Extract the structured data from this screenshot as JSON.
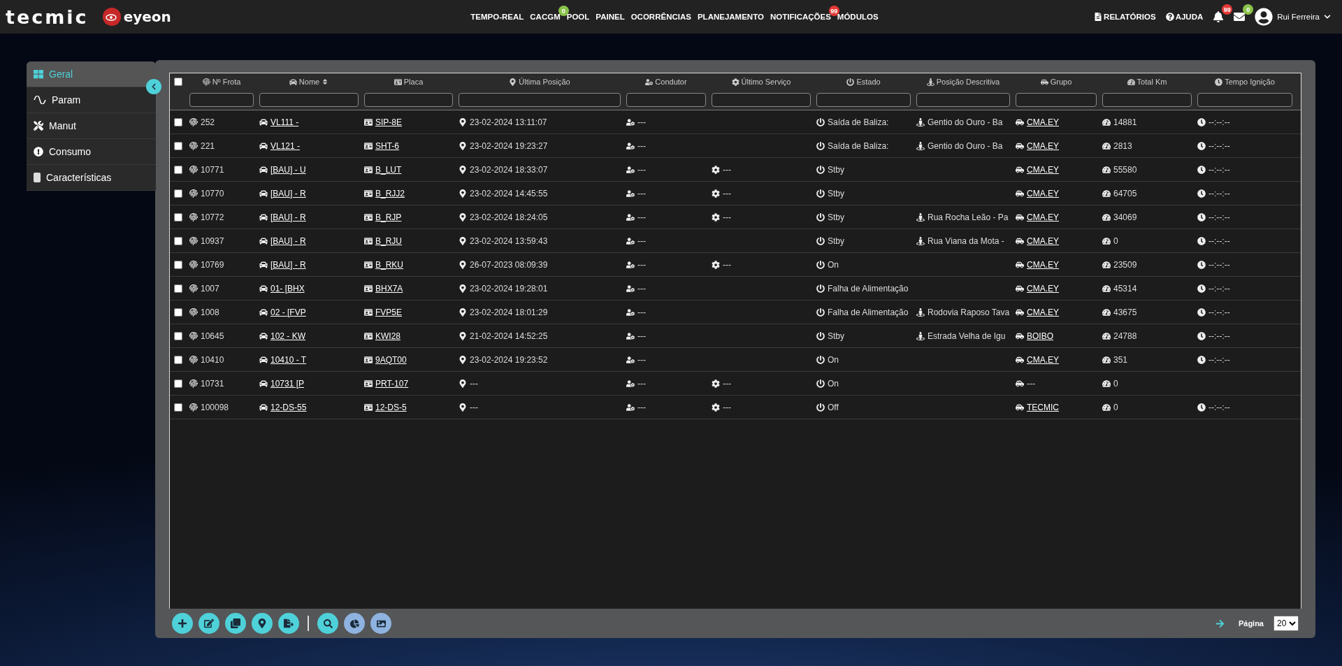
{
  "brand": {
    "tecmic": "tecmic",
    "eyeon": "eyeon"
  },
  "nav": [
    {
      "label": "TEMPO-REAL"
    },
    {
      "label": "CACGM",
      "badge": {
        "text": "0",
        "color": "#8bc34a"
      }
    },
    {
      "label": "POOL"
    },
    {
      "label": "PAINEL"
    },
    {
      "label": "OCORRÊNCIAS"
    },
    {
      "label": "PLANEJAMENTO"
    },
    {
      "label": "NOTIFICAÇÕES",
      "badge": {
        "text": "99",
        "color": "#e53935"
      }
    },
    {
      "label": "MÓDULOS"
    }
  ],
  "top_right": {
    "reports": "RELATÓRIOS",
    "help": "AJUDA",
    "bell_badge": {
      "text": "99",
      "color": "#e53935"
    },
    "mail_badge": {
      "text": "0",
      "color": "#8bc34a"
    },
    "user": "Rui Ferreira"
  },
  "sidebar": {
    "items": [
      {
        "label": "Geral",
        "selected": true
      },
      {
        "label": "Param",
        "selected": false
      },
      {
        "label": "Manut",
        "selected": false
      },
      {
        "label": "Consumo",
        "selected": false
      },
      {
        "label": "Características",
        "selected": false
      }
    ]
  },
  "table": {
    "select_all_checked": false,
    "columns": [
      {
        "label": "Nº Frota",
        "sortable": false
      },
      {
        "label": "Nome",
        "sortable": true
      },
      {
        "label": "Placa",
        "sortable": false
      },
      {
        "label": "Última Posição",
        "sortable": false
      },
      {
        "label": "Condutor",
        "sortable": false
      },
      {
        "label": "Último Serviço",
        "sortable": false
      },
      {
        "label": "Estado",
        "sortable": false
      },
      {
        "label": "Posição Descritiva",
        "sortable": false
      },
      {
        "label": "Grupo",
        "sortable": false
      },
      {
        "label": "Total Km",
        "sortable": false
      },
      {
        "label": "Tempo Ignição",
        "sortable": false
      }
    ],
    "rows": [
      {
        "checked": false,
        "frota": "252",
        "nome": "VL111 -",
        "placa": "SIP-8E",
        "posicao": "23-02-2024 13:11:07",
        "condutor": "---",
        "estado": "Saída de Baliza:",
        "local": "Gentio do Ouro - Ba",
        "grupo": "CMA.EY",
        "grupo_linked": true,
        "km": "14881",
        "ignicao": "--:--:--"
      },
      {
        "checked": false,
        "frota": "221",
        "nome": "VL121 -",
        "placa": "SHT-6",
        "posicao": "23-02-2024 19:23:27",
        "condutor": "---",
        "estado": "Saída de Baliza:",
        "local": "Gentio do Ouro - Ba",
        "grupo": "CMA.EY",
        "grupo_linked": true,
        "km": "2813",
        "ignicao": "--:--:--"
      },
      {
        "checked": false,
        "frota": "10771",
        "nome": "[BAU] - U",
        "placa": "B_LUT",
        "posicao": "23-02-2024 18:33:07",
        "condutor": "---",
        "servico": "---",
        "estado": "Stby",
        "grupo": "CMA.EY",
        "grupo_linked": true,
        "km": "55580",
        "ignicao": "--:--:--"
      },
      {
        "checked": false,
        "frota": "10770",
        "nome": "[BAU] - R",
        "placa": "B_RJJ2",
        "posicao": "23-02-2024 14:45:55",
        "condutor": "---",
        "servico": "---",
        "estado": "Stby",
        "grupo": "CMA.EY",
        "grupo_linked": true,
        "km": "64705",
        "ignicao": "--:--:--"
      },
      {
        "checked": false,
        "frota": "10772",
        "nome": "[BAU] - R",
        "placa": "B_RJP",
        "posicao": "23-02-2024 18:24:05",
        "condutor": "---",
        "servico": "---",
        "estado": "Stby",
        "local": "Rua Rocha Leão - Pa",
        "grupo": "CMA.EY",
        "grupo_linked": true,
        "km": "34069",
        "ignicao": "--:--:--"
      },
      {
        "checked": false,
        "frota": "10937",
        "nome": "[BAU] - R",
        "placa": "B_RJU",
        "posicao": "23-02-2024 13:59:43",
        "condutor": "---",
        "estado": "Stby",
        "local": "Rua Viana da Mota -",
        "grupo": "CMA.EY",
        "grupo_linked": true,
        "km": "0",
        "ignicao": "--:--:--"
      },
      {
        "checked": false,
        "frota": "10769",
        "nome": "[BAU] - R",
        "placa": "B_RKU",
        "posicao": "26-07-2023 08:09:39",
        "condutor": "---",
        "servico": "---",
        "estado": "On",
        "grupo": "CMA.EY",
        "grupo_linked": true,
        "km": "23509",
        "ignicao": "--:--:--"
      },
      {
        "checked": false,
        "frota": "1007",
        "nome": "01- [BHX",
        "placa": "BHX7A",
        "posicao": "23-02-2024 19:28:01",
        "condutor": "---",
        "estado": "Falha de Alimentação",
        "grupo": "CMA.EY",
        "grupo_linked": true,
        "km": "45314",
        "ignicao": "--:--:--"
      },
      {
        "checked": false,
        "frota": "1008",
        "nome": "02 - [FVP",
        "placa": "FVP5E",
        "posicao": "23-02-2024 18:01:29",
        "condutor": "---",
        "estado": "Falha de Alimentação",
        "local": "Rodovia Raposo Tava",
        "grupo": "CMA.EY",
        "grupo_linked": true,
        "km": "43675",
        "ignicao": "--:--:--"
      },
      {
        "checked": false,
        "frota": "10645",
        "nome": "102 - KW",
        "placa": "KWI28",
        "posicao": "21-02-2024 14:52:25",
        "condutor": "---",
        "estado": "Stby",
        "local": "Estrada Velha de Igu",
        "grupo": "BOIBO",
        "grupo_linked": true,
        "km": "24788",
        "ignicao": "--:--:--"
      },
      {
        "checked": false,
        "frota": "10410",
        "nome": "10410 - T",
        "placa": "9AQT00",
        "posicao": "23-02-2024 19:23:52",
        "condutor": "---",
        "estado": "On",
        "grupo": "CMA.EY",
        "grupo_linked": true,
        "km": "351",
        "ignicao": "--:--:--"
      },
      {
        "checked": false,
        "frota": "10731",
        "nome": "10731 [P",
        "placa": "PRT-107",
        "posicao": "---",
        "condutor": "---",
        "servico": "---",
        "estado": "On",
        "grupo": "---",
        "grupo_linked": false,
        "km": "0"
      },
      {
        "checked": false,
        "frota": "100098",
        "nome": "12-DS-55",
        "placa": "12-DS-5",
        "posicao": "---",
        "condutor": "---",
        "servico": "---",
        "estado": "Off",
        "grupo": "TECMIC",
        "grupo_linked": true,
        "km": "0",
        "ignicao": "--:--:--"
      }
    ]
  },
  "pagination": {
    "label": "Página",
    "page_size": "20"
  }
}
